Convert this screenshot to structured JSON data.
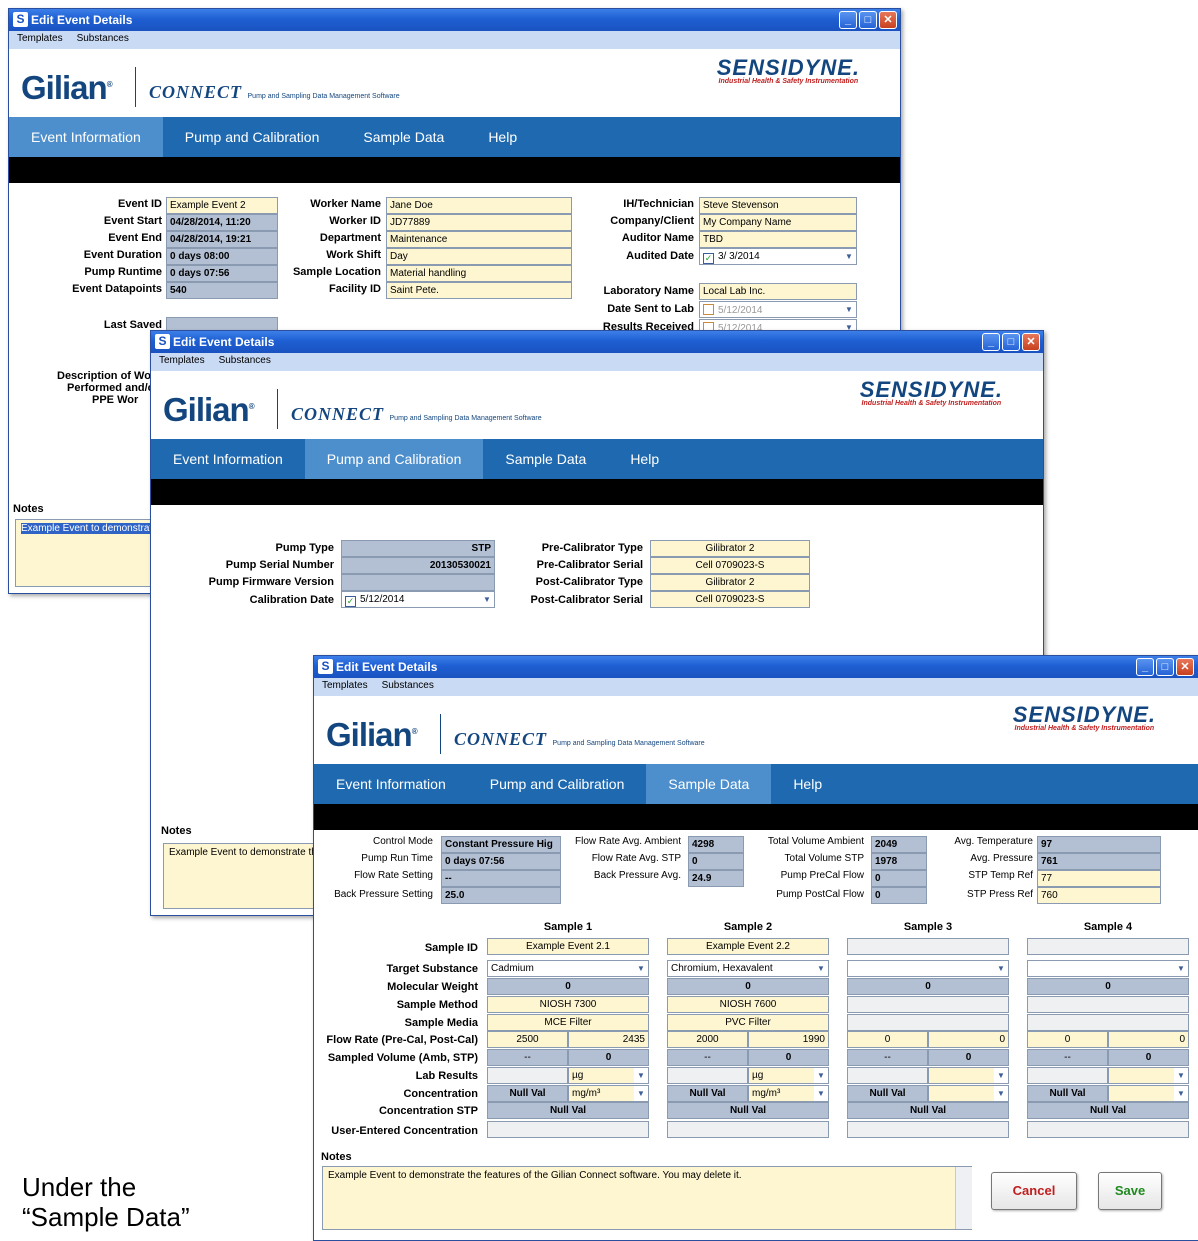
{
  "common": {
    "title": "Edit Event Details",
    "menu": [
      "Templates",
      "Substances"
    ],
    "logo": "Gilian",
    "logo_reg": "®",
    "connect": "CONNECT",
    "connect_sub": "Pump and Sampling Data Management Software",
    "brand": "SENSIDYNE.",
    "brand_sub": "Industrial Health & Safety Instrumentation",
    "tabs": [
      "Event Information",
      "Pump and Calibration",
      "Sample Data",
      "Help"
    ]
  },
  "w1": {
    "left_labels": [
      "Event ID",
      "Event Start",
      "Event End",
      "Event Duration",
      "Pump Runtime",
      "Event Datapoints"
    ],
    "left_values": [
      "Example Event 2",
      "04/28/2014, 11:20",
      "04/28/2014, 19:21",
      "0 days  08:00",
      "0 days  07:56",
      "540"
    ],
    "mid_labels": [
      "Worker Name",
      "Worker ID",
      "Department",
      "Work Shift",
      "Sample Location",
      "Facility ID"
    ],
    "mid_values": [
      "Jane Doe",
      "JD77889",
      "Maintenance",
      "Day",
      "Material handling",
      "Saint Pete."
    ],
    "right_labels": [
      "IH/Technician",
      "Company/Client",
      "Auditor Name",
      "Audited Date"
    ],
    "right_values": [
      "Steve Stevenson",
      "My Company Name",
      "TBD",
      "3/  3/2014"
    ],
    "lab_labels": [
      "Laboratory Name",
      "Date Sent to Lab",
      "Results Received"
    ],
    "lab_values": [
      "Local Lab Inc.",
      "5/12/2014",
      "5/12/2014"
    ],
    "last_saved": "Last Saved",
    "desc": "Description of Wor",
    "desc2": "Performed and/o",
    "desc3": "PPE Wor",
    "notes_label": "Notes",
    "notes": "Example Event to demonstrat"
  },
  "w2": {
    "left_labels": [
      "Pump Type",
      "Pump Serial Number",
      "Pump Firmware Version",
      "Calibration Date"
    ],
    "left_values": [
      "STP",
      "20130530021",
      "",
      "5/12/2014"
    ],
    "right_labels": [
      "Pre-Calibrator Type",
      "Pre-Calibrator Serial",
      "Post-Calibrator Type",
      "Post-Calibrator Serial"
    ],
    "right_values": [
      "Gilibrator 2",
      "Cell 0709023-S",
      "Gilibrator 2",
      "Cell 0709023-S"
    ],
    "notes_label": "Notes",
    "notes": "Example Event to demonstrate the"
  },
  "w3": {
    "c1_labels": [
      "Control Mode",
      "Pump Run Time",
      "Flow Rate Setting",
      "Back Pressure Setting"
    ],
    "c1_values": [
      "Constant Pressure Hig",
      "0 days  07:56",
      "--",
      "25.0"
    ],
    "c2_labels": [
      "Flow Rate Avg. Ambient",
      "Flow Rate Avg. STP",
      "Back Pressure Avg."
    ],
    "c2_values": [
      "4298",
      "0",
      "24.9"
    ],
    "c3_labels": [
      "Total Volume Ambient",
      "Total Volume STP",
      "Pump PreCal Flow",
      "Pump PostCal Flow"
    ],
    "c3_values": [
      "2049",
      "1978",
      "0",
      "0"
    ],
    "c4_labels": [
      "Avg. Temperature",
      "Avg. Pressure",
      "STP Temp Ref",
      "STP Press Ref"
    ],
    "c4_values": [
      "97",
      "761",
      "77",
      "760"
    ],
    "row_labels": [
      "Sample ID",
      "Target Substance",
      "Molecular Weight",
      "Sample Method",
      "Sample Media",
      "Flow Rate (Pre-Cal, Post-Cal)",
      "Sampled Volume (Amb, STP)",
      "Lab Results",
      "Concentration",
      "Concentration STP",
      "User-Entered Concentration"
    ],
    "samples": [
      {
        "h": "Sample 1",
        "id": "Example Event 2.1",
        "sub": "Cadmium",
        "mw": "0",
        "method": "NIOSH 7300",
        "media": "MCE Filter",
        "f1": "2500",
        "f2": "2435",
        "v1": "--",
        "v2": "0",
        "unit": "µg",
        "conc": "Null Val",
        "cunit": "mg/m³",
        "stp": "Null Val"
      },
      {
        "h": "Sample 2",
        "id": "Example Event 2.2",
        "sub": "Chromium, Hexavalent",
        "mw": "0",
        "method": "NIOSH 7600",
        "media": "PVC Filter",
        "f1": "2000",
        "f2": "1990",
        "v1": "--",
        "v2": "0",
        "unit": "µg",
        "conc": "Null Val",
        "cunit": "mg/m³",
        "stp": "Null Val"
      },
      {
        "h": "Sample 3",
        "id": "",
        "sub": "",
        "mw": "0",
        "method": "",
        "media": "",
        "f1": "0",
        "f2": "0",
        "v1": "--",
        "v2": "0",
        "unit": "",
        "conc": "Null Val",
        "cunit": "",
        "stp": "Null Val"
      },
      {
        "h": "Sample 4",
        "id": "",
        "sub": "",
        "mw": "0",
        "method": "",
        "media": "",
        "f1": "0",
        "f2": "0",
        "v1": "--",
        "v2": "0",
        "unit": "",
        "conc": "Null Val",
        "cunit": "",
        "stp": "Null Val"
      }
    ],
    "notes_label": "Notes",
    "notes": "Example Event to demonstrate the features of the Gilian Connect software.  You may delete it.",
    "cancel": "Cancel",
    "save": "Save"
  },
  "caption": [
    "Under the",
    "“Sample Data”"
  ]
}
